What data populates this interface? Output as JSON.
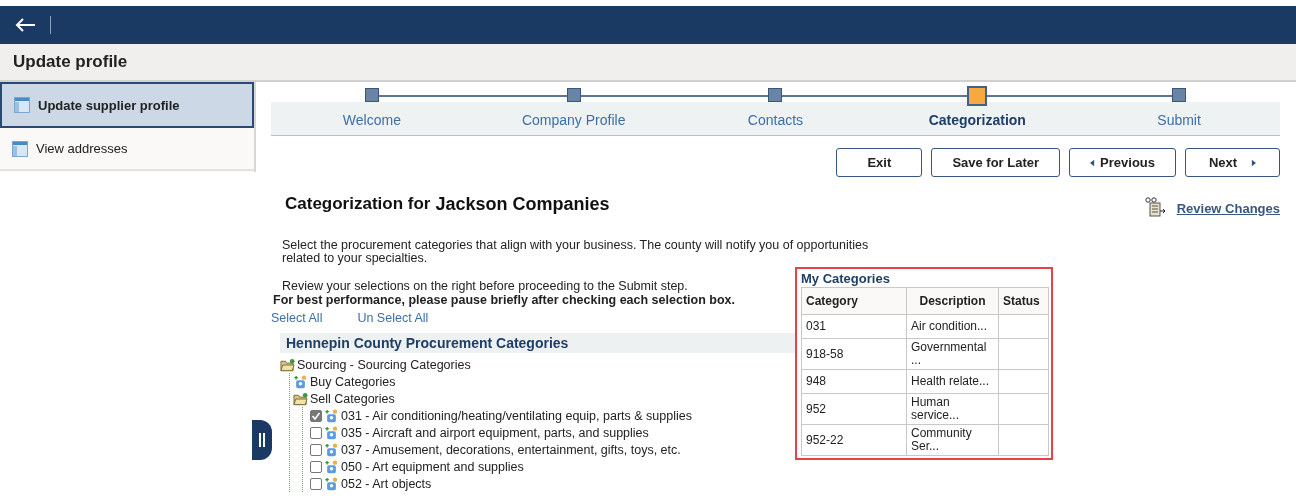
{
  "page_title": "Update profile",
  "sidebar": {
    "items": [
      {
        "label": "Update supplier profile",
        "selected": true
      },
      {
        "label": "View addresses",
        "selected": false
      }
    ]
  },
  "steps": [
    {
      "label": "Welcome",
      "selected": false
    },
    {
      "label": "Company Profile",
      "selected": false
    },
    {
      "label": "Contacts",
      "selected": false
    },
    {
      "label": "Categorization",
      "selected": true
    },
    {
      "label": "Submit",
      "selected": false
    }
  ],
  "buttons": {
    "exit": "Exit",
    "save": "Save for Later",
    "previous": "Previous",
    "next": "Next"
  },
  "heading": {
    "prefix": "Categorization for",
    "company": "Jackson Companies"
  },
  "review_link": "Review Changes",
  "intro": "Select the procurement categories that align with your business. The county will notify you of opportunities related to your specialties.",
  "review_note": "Review your selections on the right before proceeding to the Submit step.",
  "performance_note": "For best performance, please pause briefly after checking each selection box.",
  "select_all": "Select All",
  "unselect_all": "Un Select All",
  "tree_title": "Hennepin County Procurement Categories",
  "tree": [
    {
      "kind": "folder",
      "label": "Sourcing - Sourcing Categories",
      "children": [
        {
          "kind": "node",
          "label": "Buy Categories"
        },
        {
          "kind": "folder",
          "label": "Sell Categories",
          "children": [
            {
              "kind": "leaf",
              "label": "031 - Air conditioning/heating/ventilating equip, parts & supplies",
              "checked": true
            },
            {
              "kind": "leaf",
              "label": "035 - Aircraft and airport equipment, parts, and supplies",
              "checked": false
            },
            {
              "kind": "leaf",
              "label": "037 - Amusement, decorations, entertainment, gifts, toys, etc.",
              "checked": false
            },
            {
              "kind": "leaf",
              "label": "050 - Art equipment and supplies",
              "checked": false
            },
            {
              "kind": "leaf",
              "label": "052 - Art objects",
              "checked": false
            }
          ]
        }
      ]
    }
  ],
  "my_categories": {
    "title": "My Categories",
    "columns": [
      "Category",
      "Description",
      "Status"
    ],
    "rows": [
      {
        "category": "031",
        "description": "Air condition..."
      },
      {
        "category": "918-58",
        "description": "Governmental ..."
      },
      {
        "category": "948",
        "description": "Health relate..."
      },
      {
        "category": "952",
        "description": "Human service..."
      },
      {
        "category": "952-22",
        "description": "Community Ser..."
      }
    ]
  }
}
